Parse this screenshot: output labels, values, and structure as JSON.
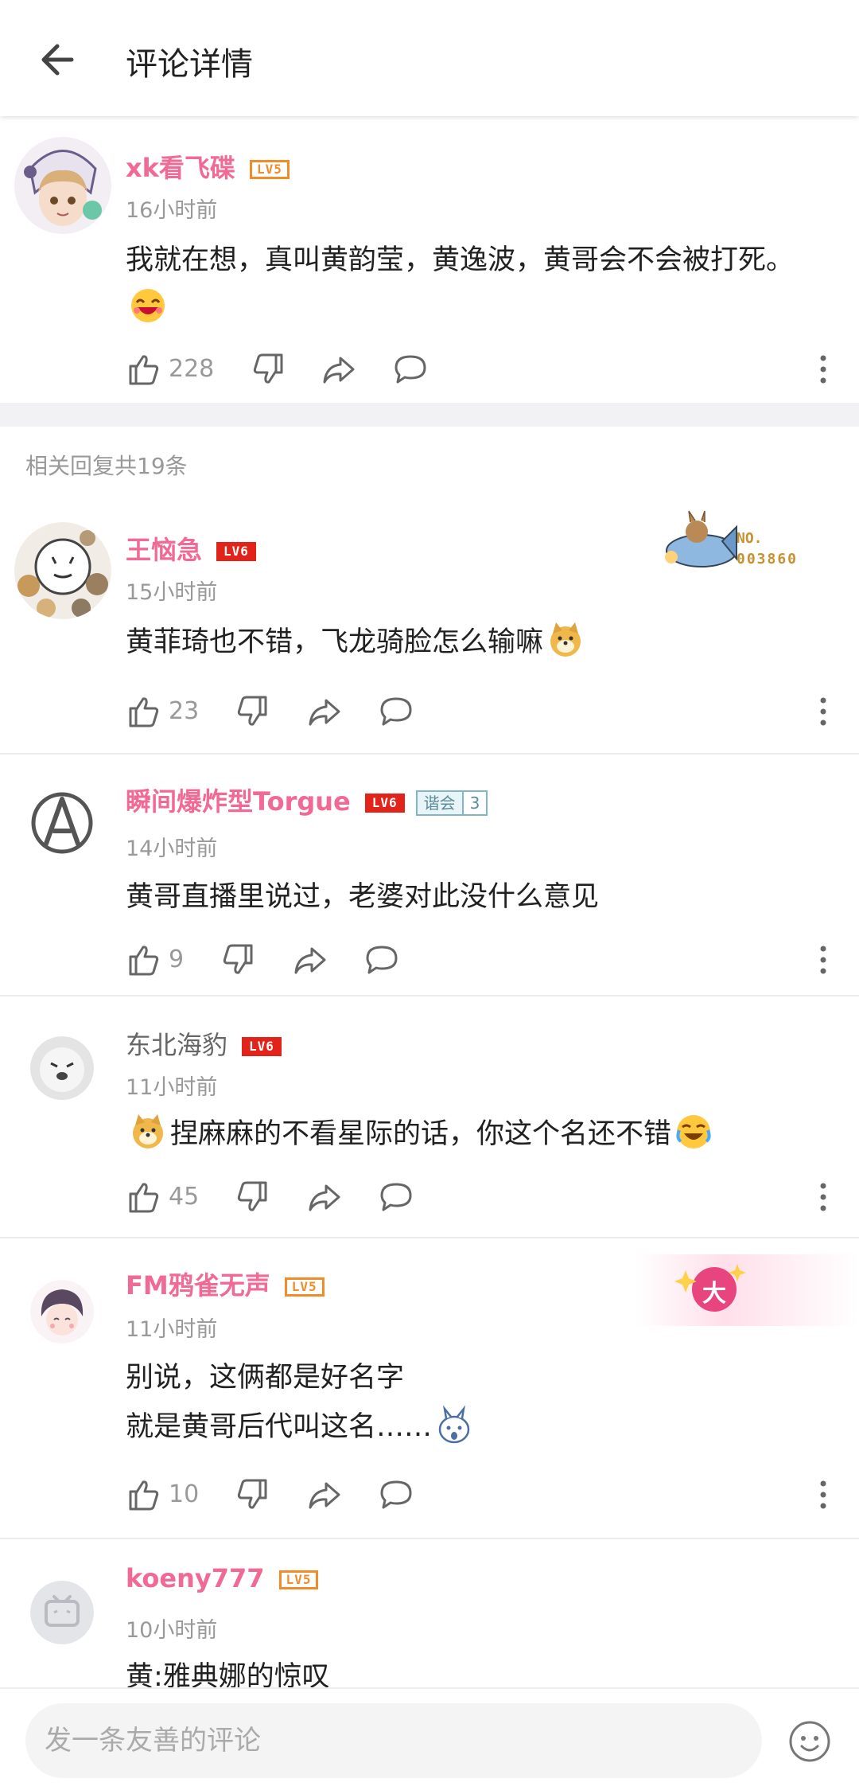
{
  "header": {
    "title": "评论详情"
  },
  "main_comment": {
    "username": "xk看飞碟",
    "level": "LV5",
    "time": "16小时前",
    "text": "我就在想，真叫黄韵莹，黄逸波，黄哥会不会被打死。",
    "likes": "228"
  },
  "replies_label": "相关回复共19条",
  "replies": [
    {
      "username": "王恼急",
      "level": "LV6",
      "time": "15小时前",
      "text": "黄菲琦也不错，飞龙骑脸怎么输嘛",
      "likes": "23",
      "pendant_text": "NO.",
      "pendant_number": "003860"
    },
    {
      "username": "瞬间爆炸型Torgue",
      "level": "LV6",
      "fan_badge_name": "谐会",
      "fan_badge_level": "3",
      "time": "14小时前",
      "text": "黄哥直播里说过，老婆对此没什么意见",
      "likes": "9"
    },
    {
      "username": "东北海豹",
      "level": "LV6",
      "time": "11小时前",
      "text": "捏麻麻的不看星际的话，你这个名还不错",
      "likes": "45"
    },
    {
      "username": "FM鸦雀无声",
      "level": "LV5",
      "time": "11小时前",
      "text_line1": "别说，这俩都是好名字",
      "text_line2": "就是黄哥后代叫这名……",
      "likes": "10",
      "pendant_char": "大"
    },
    {
      "username": "koeny777",
      "level": "LV5",
      "time": "10小时前",
      "text": "黄:雅典娜的惊叹"
    }
  ],
  "footer": {
    "placeholder": "发一条友善的评论"
  },
  "colors": {
    "username_pink": "#f06a95",
    "lv5_orange": "#f28c28",
    "lv6_red": "#e2231a",
    "meta_gray": "#999999"
  }
}
